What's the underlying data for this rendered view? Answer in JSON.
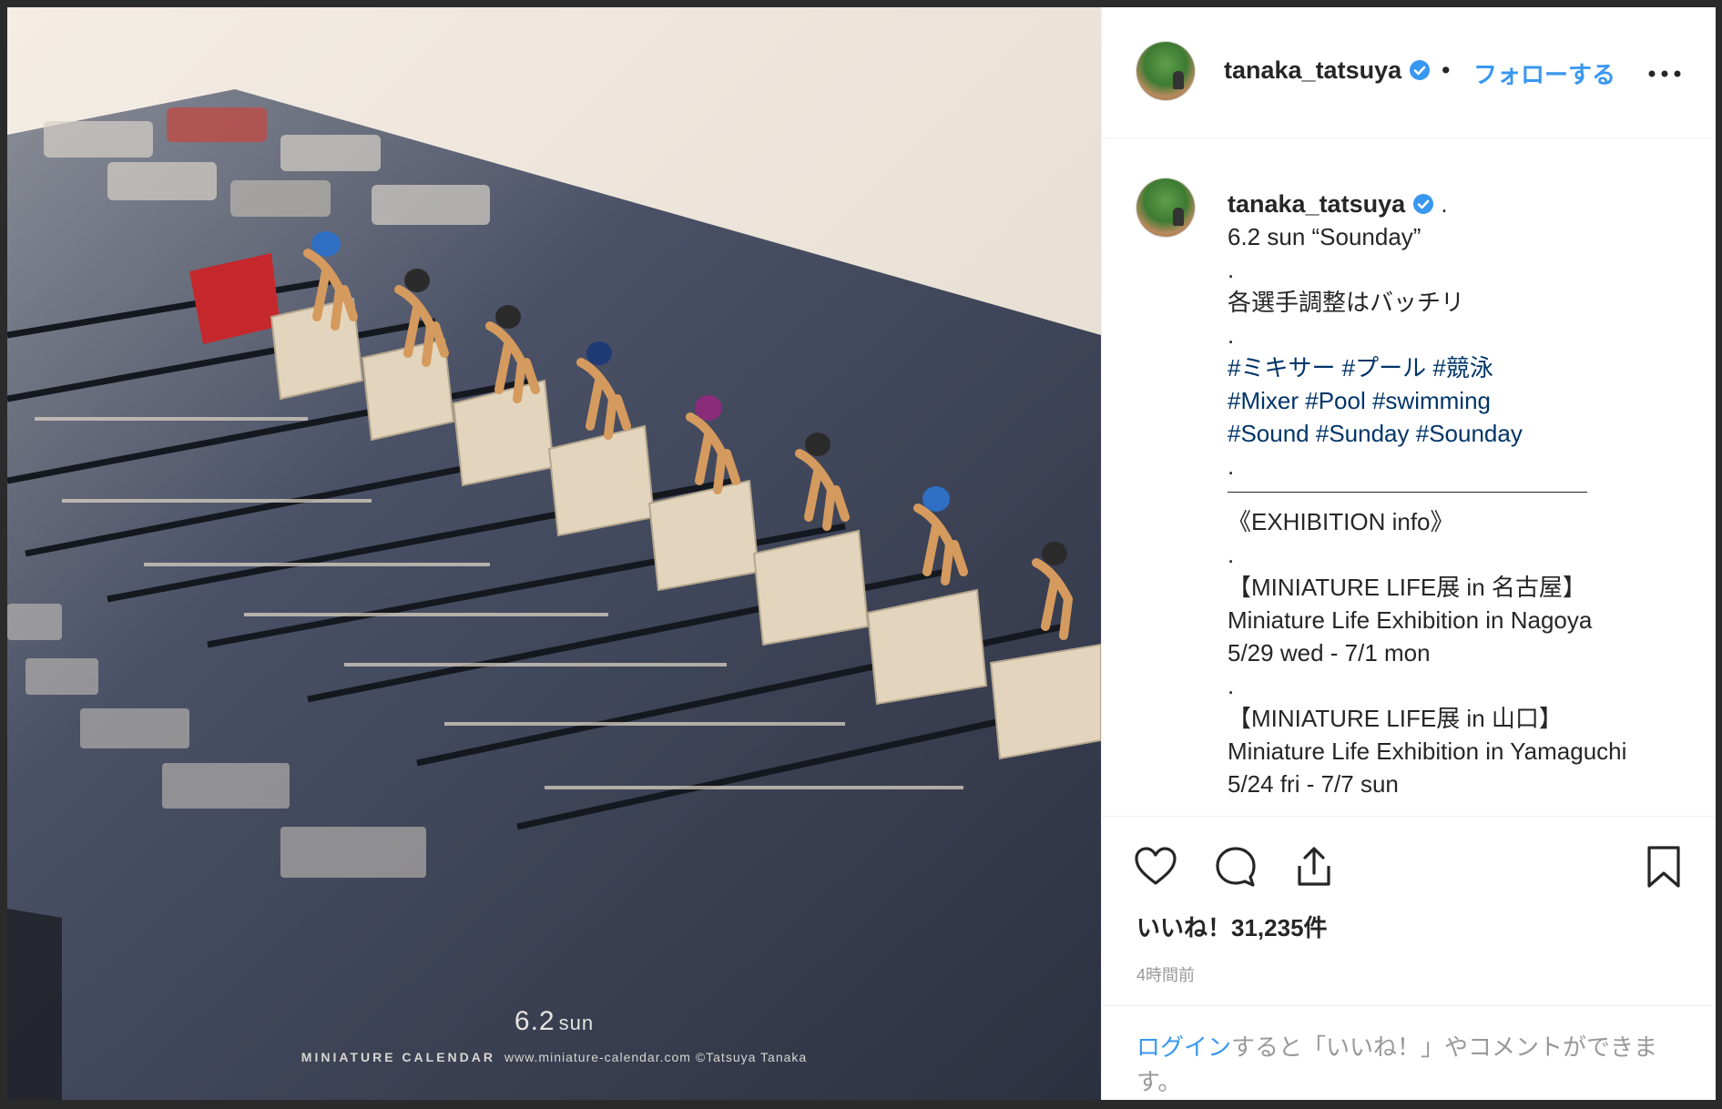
{
  "post": {
    "username": "tanaka_tatsuya",
    "follow_label": "フォローする",
    "separator": "•",
    "more_label": "…"
  },
  "photo": {
    "date_number": "6.2",
    "date_day": "sun",
    "brand": "MINIATURE CALENDAR",
    "credit": "www.miniature-calendar.com ©Tatsuya Tanaka"
  },
  "caption": {
    "username": "tanaka_tatsuya",
    "lines": [
      " .",
      "6.2 sun “Sounday”",
      ".",
      "各選手調整はバッチリ",
      ".",
      "#ミキサー #プール #競泳",
      "#Mixer #Pool #swimming",
      "#Sound #Sunday #Sounday",
      ".",
      "《EXHIBITION info》",
      ".",
      "【MINIATURE LIFE展 in 名古屋】",
      "Miniature Life Exhibition in Nagoya",
      "5/29 wed - 7/1 mon",
      ".",
      "【MINIATURE LIFE展 in 山口】",
      "Miniature Life Exhibition in Yamaguchi",
      "5/24 fri - 7/7 sun"
    ]
  },
  "actions": {
    "likes": "いいね！31,235件",
    "time": "4時間前"
  },
  "login": {
    "link": "ログイン",
    "text": "すると「いいね！」やコメントができます。"
  },
  "colors": {
    "accent": "#3897f0",
    "hashtag": "#003569",
    "text": "#262626",
    "muted": "#999999"
  }
}
